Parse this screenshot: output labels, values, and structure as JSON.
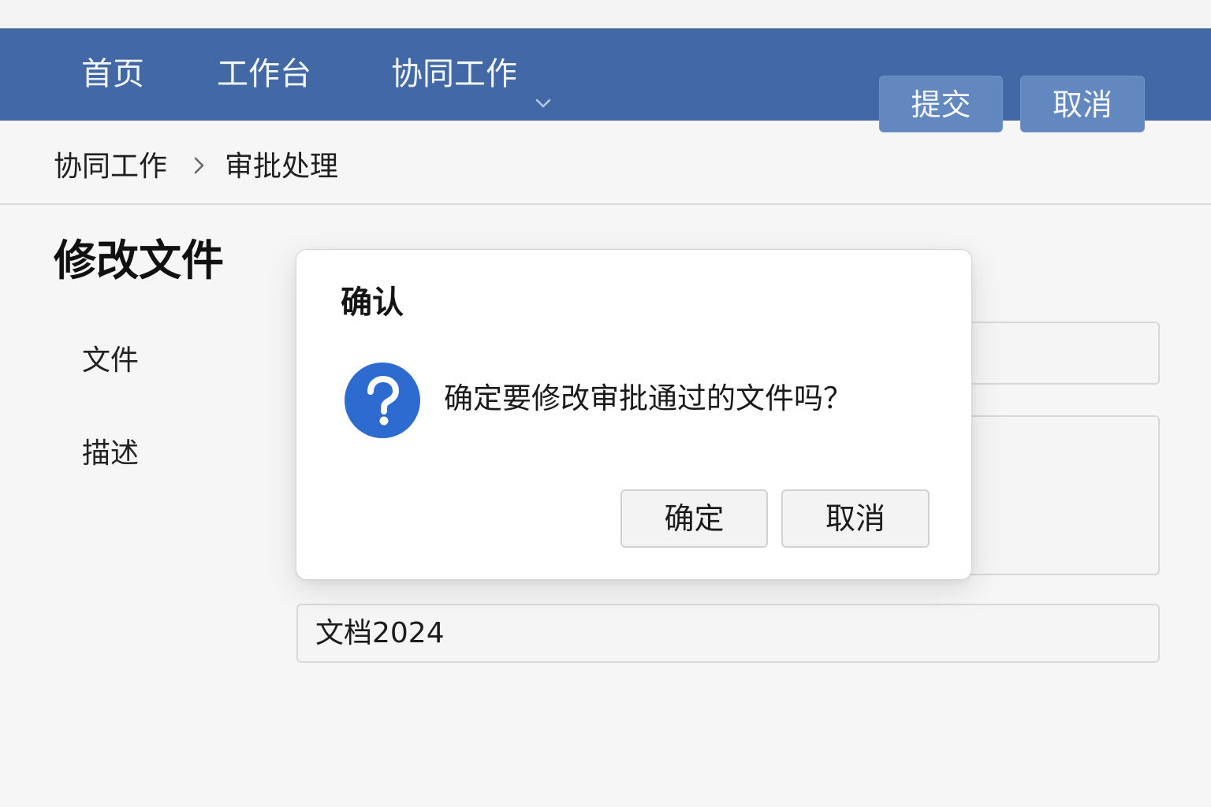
{
  "navbar": {
    "items": [
      {
        "label": "首页"
      },
      {
        "label": "工作台"
      },
      {
        "label": "协同工作"
      }
    ],
    "submit_label": "提交",
    "cancel_label": "取消",
    "dropdown_icon": "chevron-down-icon",
    "color": "#4269a5"
  },
  "breadcrumb": {
    "items": [
      "协同工作",
      "审批处理"
    ],
    "separator_icon": "chevron-right-icon"
  },
  "page": {
    "title": "修改文件",
    "form": {
      "file_label": "文件",
      "desc_label": "描述",
      "name_value": "文档2024"
    }
  },
  "dialog": {
    "title": "确认",
    "icon": "question-icon",
    "icon_color": "#2e6bd0",
    "message": "确定要修改审批通过的文件吗？",
    "ok_label": "确定",
    "cancel_label": "取消"
  }
}
